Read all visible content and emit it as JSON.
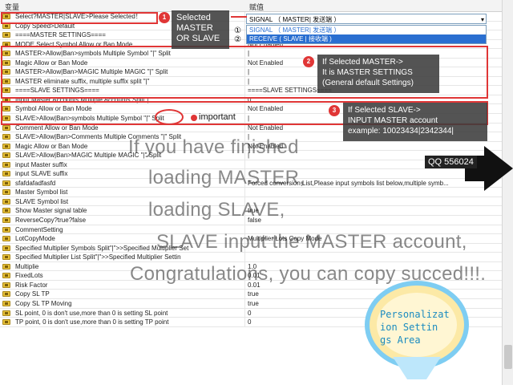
{
  "header": {
    "col_variable": "变量",
    "col_value": "赋值"
  },
  "dropdown": {
    "value": "SIGNAL （ MASTER| 发送端 ）",
    "options": [
      "SIGNAL （ MASTER| 发送端 ）",
      "RECEIVE ( SLAVE  | 接收端 )"
    ]
  },
  "rows": [
    {
      "k": "Select?MASTER|SLAVE>Please Selected！",
      "v": ""
    },
    {
      "k": "Copy Speed>Default",
      "v": ""
    },
    {
      "k": "====MASTER SETTINGS====",
      "v": ""
    },
    {
      "k": "MODE Select Symbol Allow or Ban Mode",
      "v": "Not Enabled"
    },
    {
      "k": "MASTER>Allow|Ban>symbols    Multiple Symbol \"|\" Split",
      "v": "|"
    },
    {
      "k": "Magic Allow or Ban Mode",
      "v": "Not Enabled"
    },
    {
      "k": "MASTER>Allow|Ban>MAGIC    Multiple MAGIC \"|\" Split",
      "v": "|"
    },
    {
      "k": "MASTER eliminate suffix, multiple suffix split \"|\"",
      "v": "|"
    },
    {
      "k": "====SLAVE SETTINGS====",
      "v": "====SLAVE SETTINGS===="
    },
    {
      "k": "Input Master Accounts,Multiple Accounts Split\"|\"",
      "v": "0"
    },
    {
      "k": "Symbol Allow or Ban Mode",
      "v": "Not Enabled"
    },
    {
      "k": "SLAVE>Allow|Ban>symbols    Multiple Symbol \"|\" Split",
      "v": "|"
    },
    {
      "k": "Comment Allow or Ban Mode",
      "v": "Not Enabled"
    },
    {
      "k": "SLAVE>Allow|Ban>Comments    Multiple Comments \"|\" Split",
      "v": "|"
    },
    {
      "k": "Magic Allow or Ban Mode",
      "v": "Not Enabled"
    },
    {
      "k": "SLAVE>Allow|Ban>MAGIC    Multiple MAGIC \"|\" Split",
      "v": "|"
    },
    {
      "k": "input Master suffix",
      "v": ""
    },
    {
      "k": "input SLAVE suffix",
      "v": ""
    },
    {
      "k": "sfafdafadfasfd",
      "v": "Forced conversion List,Please input symbols list below,multiple symb..."
    },
    {
      "k": "Master Symbol list",
      "v": ""
    },
    {
      "k": "SLAVE Symbol list",
      "v": ""
    },
    {
      "k": "Show Master signal table",
      "v": "true"
    },
    {
      "k": "ReverseCopy?true?false",
      "v": "false"
    },
    {
      "k": "CommentSetting",
      "v": ""
    },
    {
      "k": "LotCopyMode",
      "v": "Multiplier Lots Copy Mode"
    },
    {
      "k": "Specified Multiplier Symbols Split\"|\">>Specified Multiplier Set",
      "v": ""
    },
    {
      "k": "Specified Multiplier List Split\"|\">>Specified Multiplier Settin",
      "v": ""
    },
    {
      "k": "Multiplie",
      "v": "1.0"
    },
    {
      "k": "FixedLots",
      "v": "0.01"
    },
    {
      "k": "Risk Factor",
      "v": "0.01"
    },
    {
      "k": "Copy SL TP",
      "v": "true"
    },
    {
      "k": "Copy SL TP Moving",
      "v": "true"
    },
    {
      "k": "SL point, 0 is don't use,more than 0 is setting SL point",
      "v": "0"
    },
    {
      "k": "TP point, 0 is don't use,more than 0 is setting TP point",
      "v": "0"
    }
  ],
  "annotations": {
    "note1_num": "1",
    "note1_text1": "Selected",
    "note1_text2": "MASTER",
    "note1_text3": "OR SLAVE",
    "circ1": "①",
    "circ2": "②",
    "note2_num": "2",
    "note2_l1": "If Selected MASTER->",
    "note2_l2": "It is MASTER SETTINGS",
    "note2_l3": "(General default Settings)",
    "note3_num": "3",
    "note3_l1": "If Selected SLAVE->",
    "note3_l2": "INPUT MASTER account",
    "note3_l3": "example: 10023434|2342344|",
    "important": "important",
    "qq": "QQ 556024",
    "big1": "If you have finished",
    "big2": "loading MASTER,",
    "big3": "loading SLAVE,",
    "big4": "SLAVE input the MASTER account,",
    "big5": "Congratulations, you can copy succed!!!.",
    "balloon_l1": "Personalizat",
    "balloon_l2": "ion  Settin",
    "balloon_l3": "gs Area"
  },
  "colors": {
    "accent_red": "#e03636",
    "select_blue": "#2a6fd1"
  }
}
